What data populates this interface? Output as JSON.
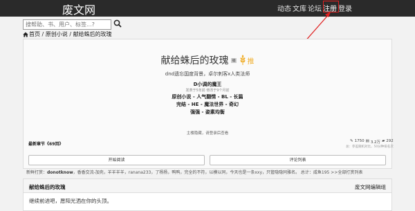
{
  "header": {
    "logo": "废文网",
    "nav": [
      "动态",
      "文库",
      "论坛",
      "注册",
      "登录"
    ]
  },
  "search": {
    "placeholder": "搜帮助、书、用户、标签...?"
  },
  "breadcrumb": [
    "首页",
    "原创小说",
    "献给蛛后的玫瑰"
  ],
  "book": {
    "title": "献给蛛后的玫瑰",
    "badge": "编",
    "tui": "推",
    "subtitle": "dnd遗忘国度背景，卓尔刺客x人类法师",
    "author": "D小调的魔王",
    "dates": "发表于5年前 修改于9个月前",
    "tags1": "原创小说 - 人气翻情 - BL - 长篇",
    "tags2": "完结 - HE - 魔法世界 - 奇幻",
    "tags3": "强强 - 姿素均衡",
    "note": "主楼隐藏，请登录后查看",
    "latest": "最新章节《69回》",
    "stats": [
      "1750",
      "3.2万",
      "292"
    ],
    "stats_sub": "总：参差随机对比，50分种排名次"
  },
  "buttons": {
    "read": "开始阅读",
    "review": "评论列表"
  },
  "tips": {
    "label": "新鲜打赏：",
    "names": "donotknow",
    "text": "，香香交流-加壳，羊羊羊羊，ranana233，了杨杨，鸭鸭，完全的不符，以模以同，今天也是一条xxy，只管隐隐同雅名。",
    "total": " 总计：咸鱼195",
    "more": ">>全部打赏列表"
  },
  "section": {
    "title": "献给蛛后的玫瑰",
    "group": "废文网编辑组",
    "body": "继续前进吧，愿阳光洒在你的头顶。"
  },
  "colors": {
    "topbar": "#2a2a2a",
    "highlight": "#e02020",
    "wheat": "#f0b030"
  }
}
